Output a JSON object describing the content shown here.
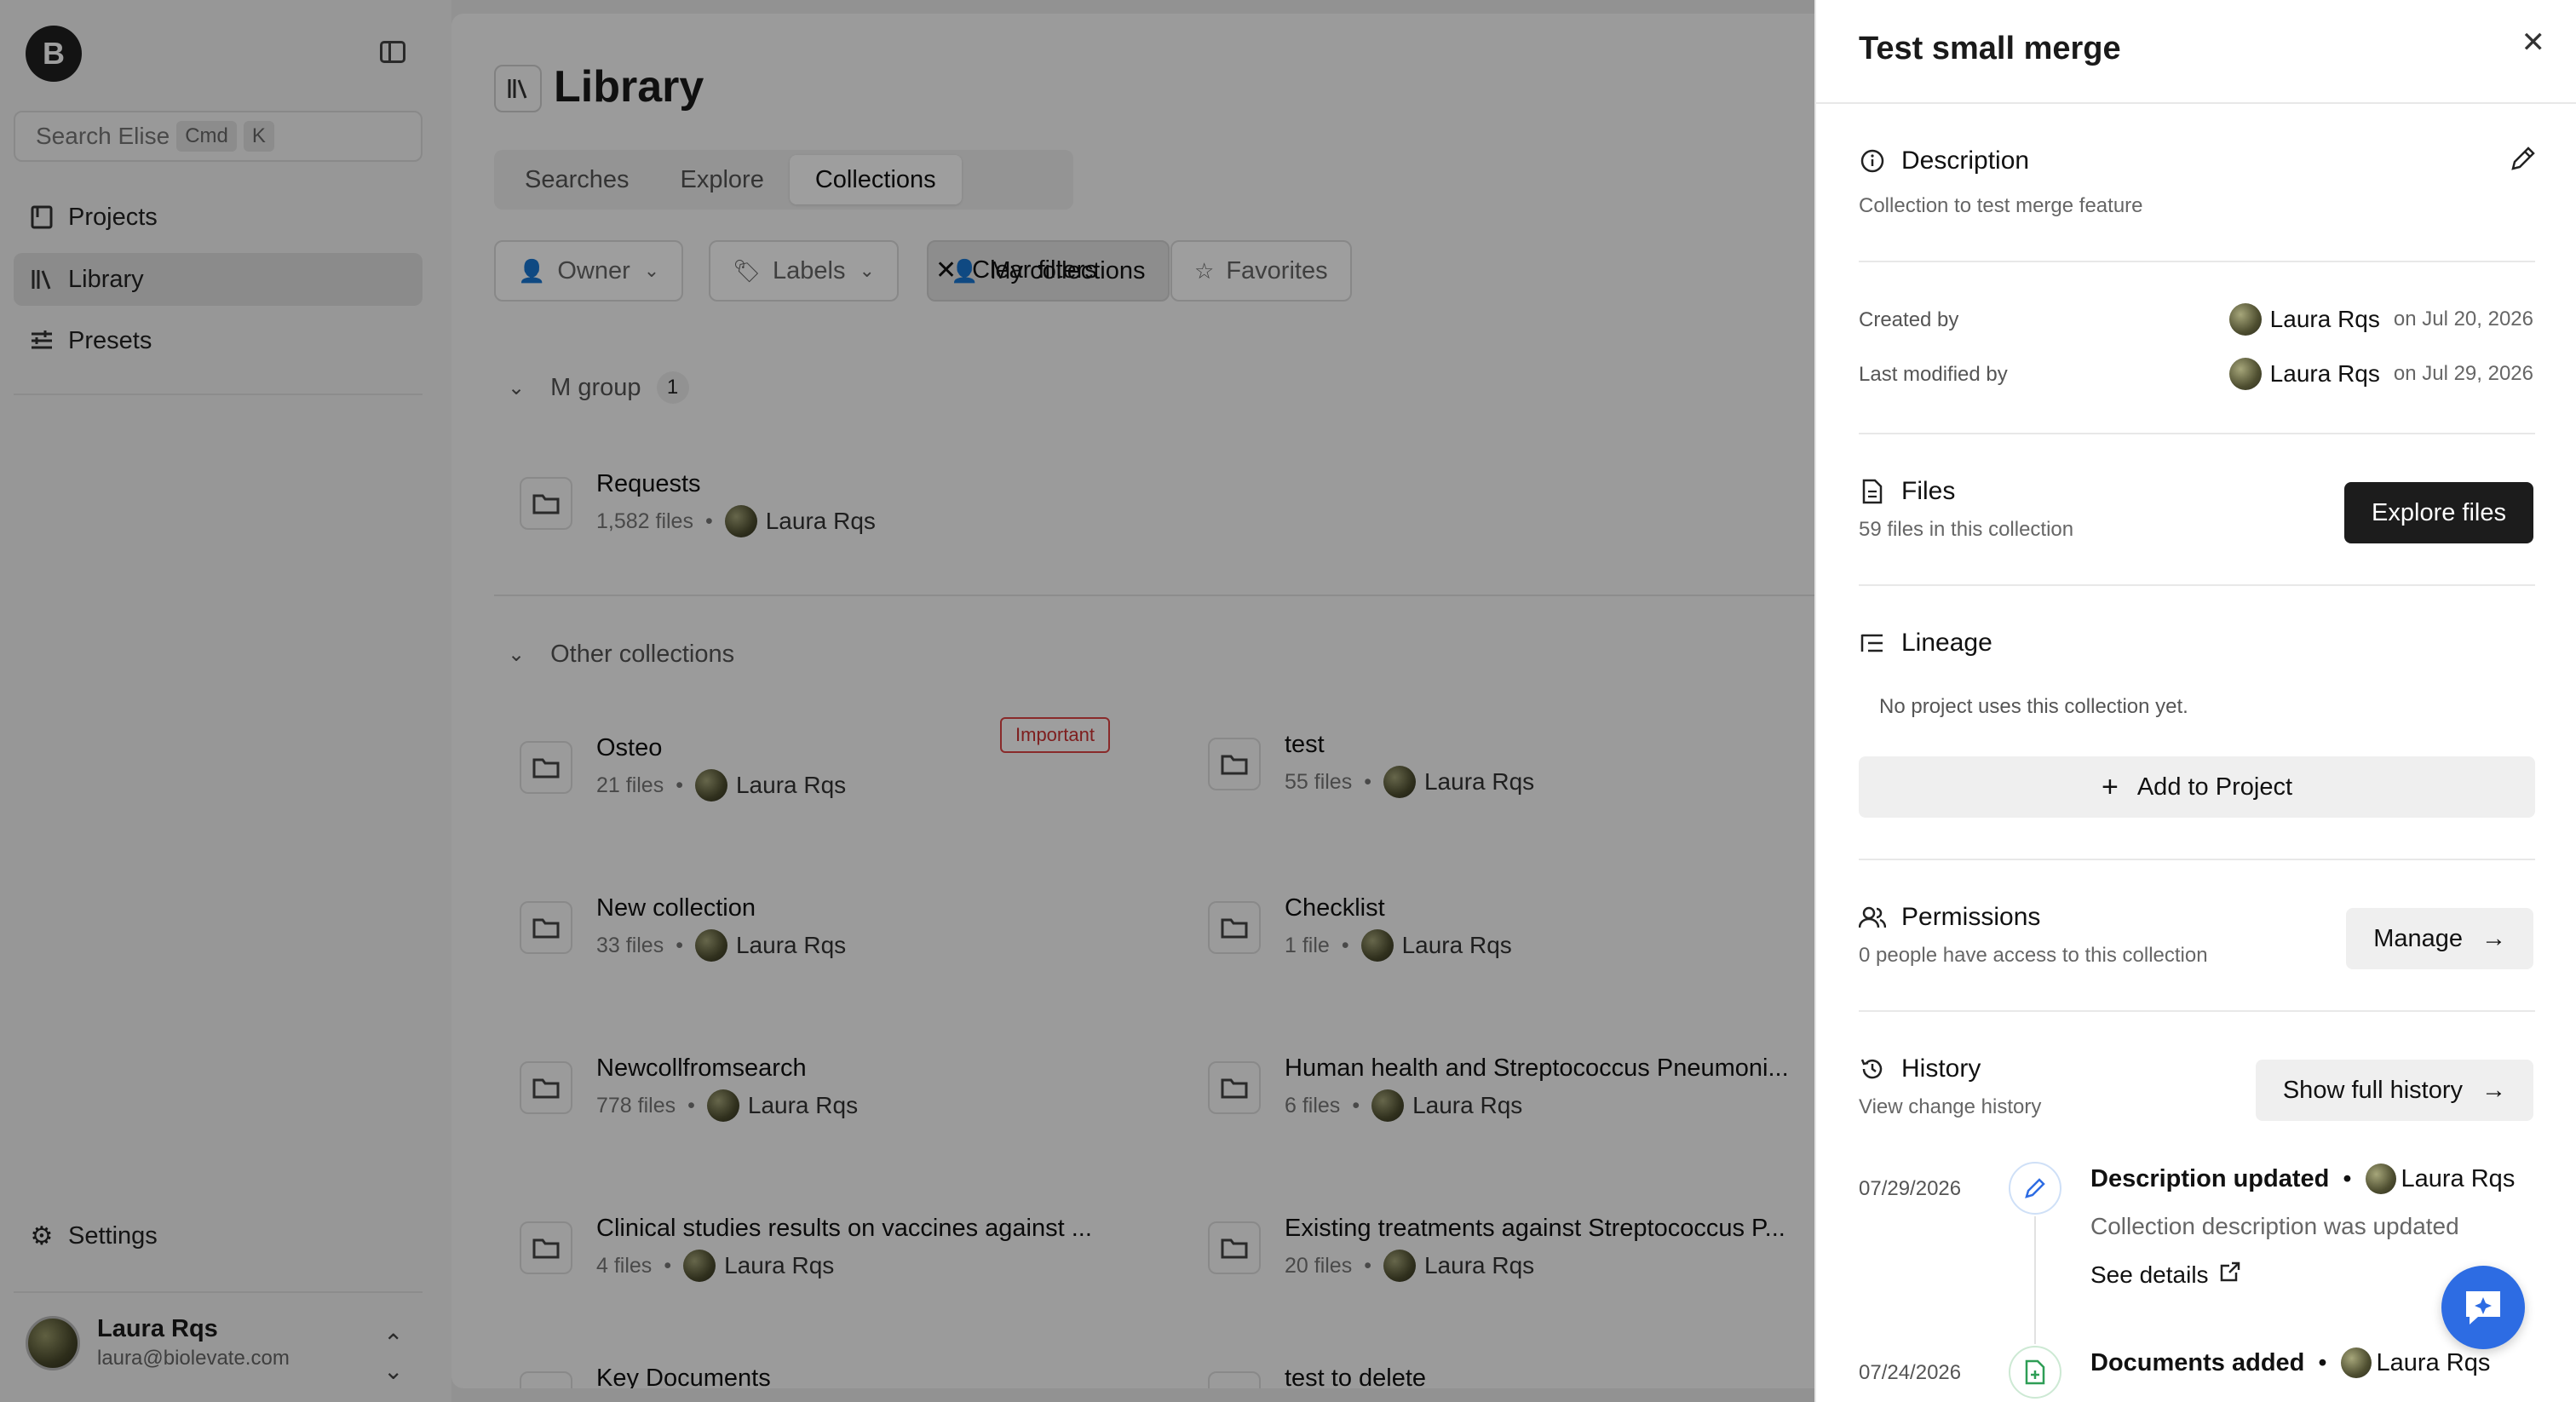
{
  "sidebar": {
    "logo_letter": "B",
    "search": {
      "placeholder": "Search Elise",
      "kbd_1": "Cmd",
      "kbd_2": "K"
    },
    "nav": [
      {
        "label": "Projects",
        "icon": "book-icon"
      },
      {
        "label": "Library",
        "icon": "library-icon",
        "active": true
      },
      {
        "label": "Presets",
        "icon": "sliders-icon"
      }
    ],
    "settings_label": "Settings",
    "user": {
      "name": "Laura Rqs",
      "email": "laura@biolevate.com"
    }
  },
  "library": {
    "title": "Library",
    "tabs": [
      {
        "label": "Searches"
      },
      {
        "label": "Explore"
      },
      {
        "label": "Collections",
        "active": true
      }
    ],
    "filters": {
      "owner": "Owner",
      "labels": "Labels",
      "my_collections": "My collections",
      "favorites": "Favorites",
      "clear": "Clear filters"
    },
    "groups": [
      {
        "name": "M group",
        "count": "1",
        "collections": [
          {
            "name": "Requests",
            "files": "1,582 files",
            "owner": "Laura Rqs"
          }
        ]
      },
      {
        "name": "Other collections",
        "collections": [
          {
            "name": "Osteo",
            "files": "21 files",
            "owner": "Laura Rqs",
            "badge": "Important"
          },
          {
            "name": "test",
            "files": "55 files",
            "owner": "Laura Rqs"
          },
          {
            "name": "New collection",
            "files": "33 files",
            "owner": "Laura Rqs"
          },
          {
            "name": "Checklist",
            "files": "1 file",
            "owner": "Laura Rqs"
          },
          {
            "name": "Newcollfromsearch",
            "files": "778 files",
            "owner": "Laura Rqs"
          },
          {
            "name": "Human health and Streptococcus Pneumoni...",
            "files": "6 files",
            "owner": "Laura Rqs"
          },
          {
            "name": "Clinical studies results on vaccines against ...",
            "files": "4 files",
            "owner": "Laura Rqs"
          },
          {
            "name": "Existing treatments against Streptococcus P...",
            "files": "20 files",
            "owner": "Laura Rqs"
          },
          {
            "name": "Key Documents"
          },
          {
            "name": "test to delete"
          }
        ]
      }
    ]
  },
  "panel": {
    "title": "Test small merge",
    "description": {
      "heading": "Description",
      "text": "Collection to test merge feature"
    },
    "created": {
      "label": "Created by",
      "user": "Laura Rqs",
      "date": "on Jul 20, 2026"
    },
    "modified": {
      "label": "Last modified by",
      "user": "Laura Rqs",
      "date": "on Jul 29, 2026"
    },
    "files": {
      "heading": "Files",
      "text": "59 files in this collection",
      "button": "Explore files"
    },
    "lineage": {
      "heading": "Lineage",
      "empty": "No project uses this collection yet.",
      "button": "Add to Project"
    },
    "permissions": {
      "heading": "Permissions",
      "text": "0 people have access to this collection",
      "button": "Manage"
    },
    "history": {
      "heading": "History",
      "text": "View change history",
      "button": "Show full history",
      "entries": [
        {
          "date": "07/29/2026",
          "title": "Description updated",
          "user": "Laura Rqs",
          "desc": "Collection description was updated",
          "link": "See details"
        },
        {
          "date": "07/24/2026",
          "title": "Documents added",
          "user": "Laura Rqs"
        }
      ]
    }
  },
  "colors": {
    "accent_blue": "#2d6ce3",
    "important_red": "#cc3333",
    "dark_button": "#1c1c1c"
  }
}
